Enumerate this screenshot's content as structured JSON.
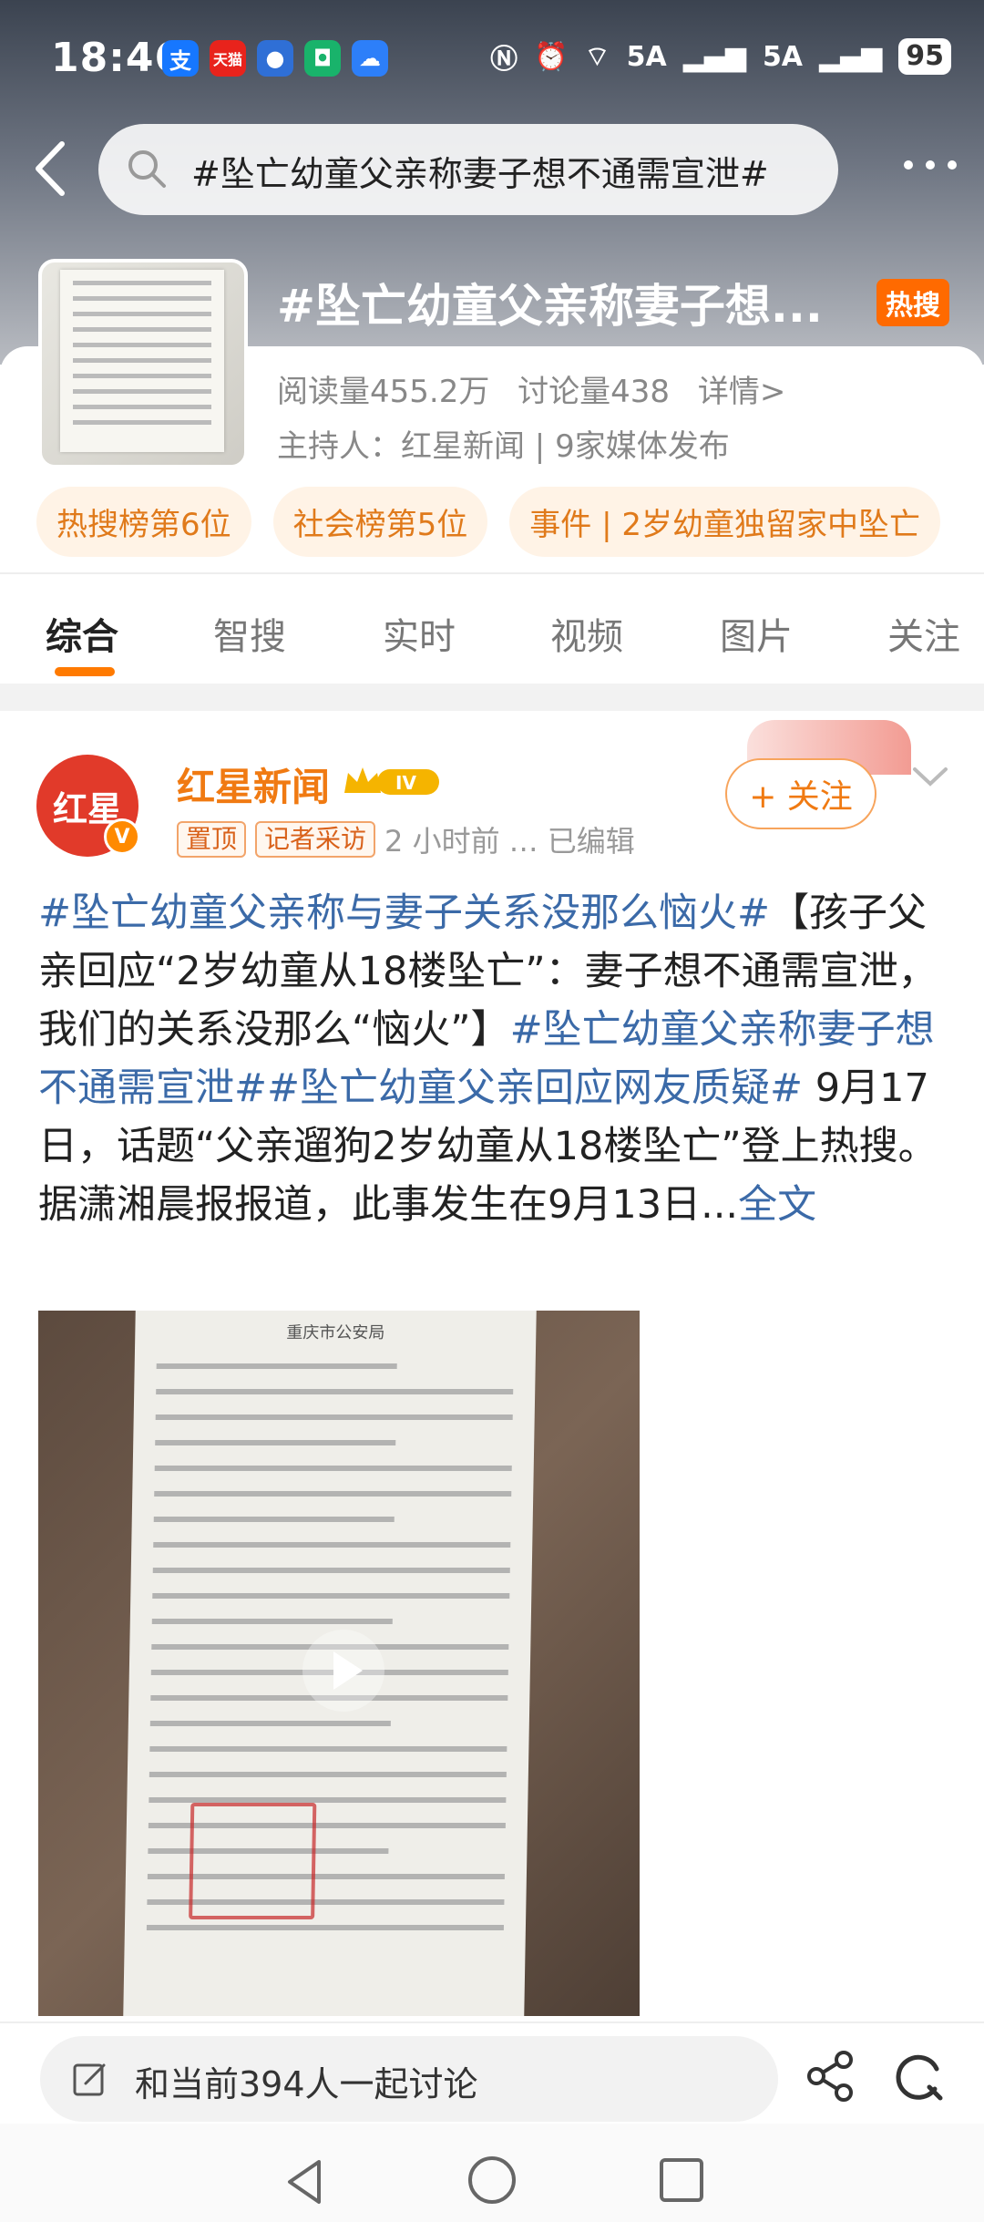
{
  "status_bar": {
    "time": "18:46",
    "app_icons": [
      "alipay-icon",
      "tmall-icon",
      "robot-icon",
      "wechat-icon",
      "cloud-icon"
    ],
    "network": "5A",
    "network2": "5A",
    "battery": "95"
  },
  "search": {
    "query": "#坠亡幼童父亲称妻子想不通需宣泄#"
  },
  "topic": {
    "title": "#坠亡幼童父亲称妻子想...",
    "badge": "热搜",
    "read": "阅读量455.2万",
    "discuss": "讨论量438",
    "details": "详情>",
    "host": "主持人：红星新闻 | 9家媒体发布",
    "chips": [
      "热搜榜第6位",
      "社会榜第5位",
      "事件 | 2岁幼童独留家中坠亡"
    ]
  },
  "tabs": [
    "综合",
    "智搜",
    "实时",
    "视频",
    "图片",
    "关注"
  ],
  "post": {
    "avatar_text": "红星",
    "avatar_verified": "V",
    "author": "红星新闻",
    "level": "IV",
    "tag_pinned": "置顶",
    "tag_reporter": "记者采访",
    "time": "2 小时前",
    "edited": "… 已编辑",
    "follow": "+ 关注",
    "text_parts": [
      {
        "t": "#坠亡幼童父亲称与妻子关系没那么恼火#",
        "hl": true
      },
      {
        "t": "【孩子父亲回应“2岁幼童从18楼坠亡”：妻子想不通需宣泄，我们的关系没那么“恼火”】",
        "hl": false
      },
      {
        "t": "#坠亡幼童父亲称妻子想不通需宣泄#",
        "hl": true
      },
      {
        "t": "#坠亡幼童父亲回应网友质疑#",
        "hl": true
      },
      {
        "t": " 9月17日，话题“父亲遛狗2岁幼童从18楼坠亡”登上热搜。据潇湘晨报报道，此事发生在9月13日...",
        "hl": false
      },
      {
        "t": "全文",
        "hl": true
      }
    ],
    "doc_header": "重庆市公安局"
  },
  "bottom": {
    "comment_placeholder": "和当前394人一起讨论"
  },
  "colors": {
    "accent": "#ff7a00",
    "link": "#3b6aa8",
    "hot": "#ff6a00"
  }
}
